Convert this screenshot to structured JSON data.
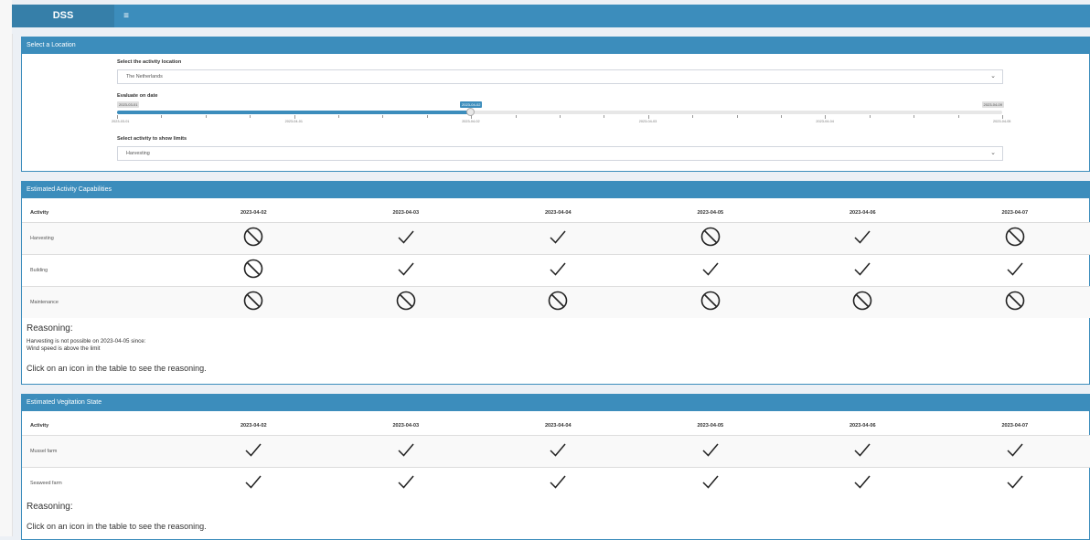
{
  "header": {
    "logo": "DSS",
    "menu_icon": "hamburger-icon",
    "menu_glyph": "≡"
  },
  "location_box": {
    "title": "Select a Location",
    "location_label": "Select the activity location",
    "location_value": "The Netherlands",
    "date_label": "Evaluate on date",
    "slider": {
      "min_label": "2023-03-01",
      "max_label": "2023-04-09",
      "current_label": "2023-04-02",
      "fraction": 0.4,
      "tick_labels": [
        "2023-03-01",
        "2023-04-01",
        "2023-04-02",
        "2023-04-03",
        "2023-04-04",
        "2023-04-05"
      ]
    },
    "activity_label": "Select activity to show limits",
    "activity_value": "Harvesting"
  },
  "capabilities": {
    "title": "Estimated Activity Capabilities",
    "columns": [
      "Activity",
      "2023-04-02",
      "2023-04-03",
      "2023-04-04",
      "2023-04-05",
      "2023-04-06",
      "2023-04-07"
    ],
    "rows": [
      {
        "name": "Harvesting",
        "cells": [
          "no",
          "ok",
          "ok",
          "no",
          "ok",
          "no"
        ]
      },
      {
        "name": "Building",
        "cells": [
          "no",
          "ok",
          "ok",
          "ok",
          "ok",
          "ok"
        ]
      },
      {
        "name": "Maintenance",
        "cells": [
          "no",
          "no",
          "no",
          "no",
          "no",
          "no"
        ]
      }
    ],
    "reasoning_title": "Reasoning:",
    "reasoning_line1": "Harvesting is not possible on 2023-04-05 since:",
    "reasoning_line2": "Wind speed is above the limit",
    "hint": "Click on an icon in the table to see the reasoning."
  },
  "vegetation": {
    "title": "Estimated Vegitation State",
    "columns": [
      "Activity",
      "2023-04-02",
      "2023-04-03",
      "2023-04-04",
      "2023-04-05",
      "2023-04-06",
      "2023-04-07"
    ],
    "rows": [
      {
        "name": "Mussel farm",
        "cells": [
          "ok",
          "ok",
          "ok",
          "ok",
          "ok",
          "ok"
        ]
      },
      {
        "name": "Seaweed farm",
        "cells": [
          "ok",
          "ok",
          "ok",
          "ok",
          "ok",
          "ok"
        ]
      }
    ],
    "reasoning_title": "Reasoning:",
    "hint": "Click on an icon in the table to see the reasoning."
  },
  "icons": {
    "ok": "check-icon",
    "no": "ban-icon"
  }
}
